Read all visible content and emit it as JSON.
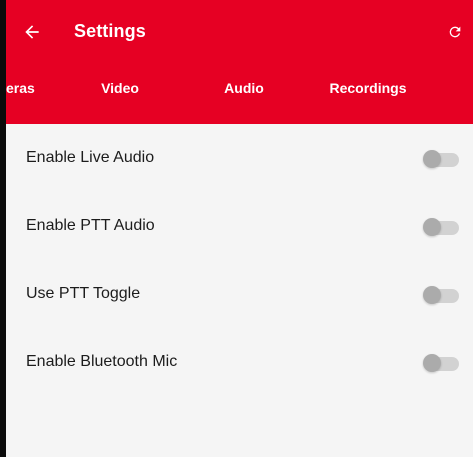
{
  "header": {
    "title": "Settings",
    "back_icon": "arrow-left-icon",
    "refresh_icon": "refresh-icon"
  },
  "tabs": [
    {
      "label": "eras",
      "selected": false
    },
    {
      "label": "Video",
      "selected": false
    },
    {
      "label": "Audio",
      "selected": true
    },
    {
      "label": "Recordings",
      "selected": false
    }
  ],
  "settings": [
    {
      "label": "Enable Live Audio",
      "enabled": false
    },
    {
      "label": "Enable PTT Audio",
      "enabled": false
    },
    {
      "label": "Use PTT Toggle",
      "enabled": false
    },
    {
      "label": "Enable Bluetooth Mic",
      "enabled": false
    }
  ],
  "colors": {
    "accent": "#e60023",
    "background": "#f5f5f5",
    "text": "#1c1c1c",
    "switch_track_off": "#d2d2d2",
    "switch_thumb_off": "#ababab"
  }
}
